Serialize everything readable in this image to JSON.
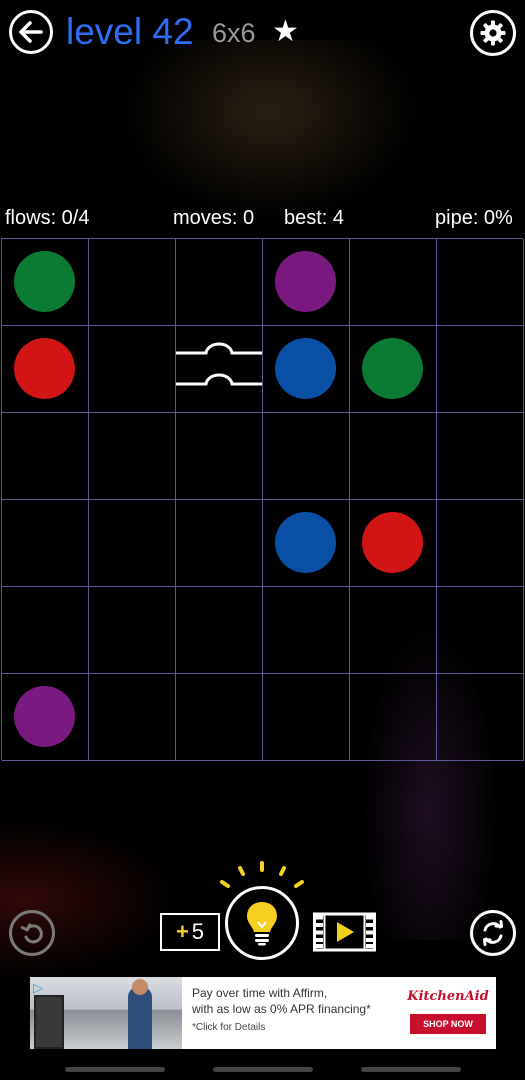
{
  "header": {
    "level_title": "level 42",
    "grid_size": "6x6",
    "star": "★",
    "back_icon": "arrow-left-icon",
    "settings_icon": "gear-icon"
  },
  "stats": {
    "flows": "flows: 0/4",
    "moves": "moves: 0",
    "best": "best: 4",
    "pipe": "pipe: 0%"
  },
  "board": {
    "rows": 6,
    "cols": 6,
    "grid_color": "#5a5a9a",
    "dots": [
      {
        "row": 0,
        "col": 0,
        "color": "#0b7a32",
        "name": "green"
      },
      {
        "row": 0,
        "col": 3,
        "color": "#7a1a80",
        "name": "purple"
      },
      {
        "row": 1,
        "col": 0,
        "color": "#d11414",
        "name": "red"
      },
      {
        "row": 1,
        "col": 3,
        "color": "#0a4fa6",
        "name": "blue"
      },
      {
        "row": 1,
        "col": 4,
        "color": "#0b7a32",
        "name": "green"
      },
      {
        "row": 3,
        "col": 3,
        "color": "#0a4fa6",
        "name": "blue"
      },
      {
        "row": 3,
        "col": 4,
        "color": "#d11414",
        "name": "red"
      },
      {
        "row": 5,
        "col": 0,
        "color": "#7a1a80",
        "name": "purple"
      }
    ],
    "bridges": [
      {
        "row": 1,
        "col": 2
      }
    ]
  },
  "controls": {
    "undo_icon": "undo-icon",
    "hints_plus": "+",
    "hints_count": "5",
    "hint_icon": "lightbulb-icon",
    "video_icon": "video-play-icon",
    "refresh_icon": "refresh-icon"
  },
  "ad": {
    "line1": "Pay over time with Affirm,",
    "line2": "with as low as 0% APR financing*",
    "note": "*Click for Details",
    "brand": "KitchenAid",
    "cta": "SHOP NOW",
    "brand_color": "#c8102e"
  }
}
